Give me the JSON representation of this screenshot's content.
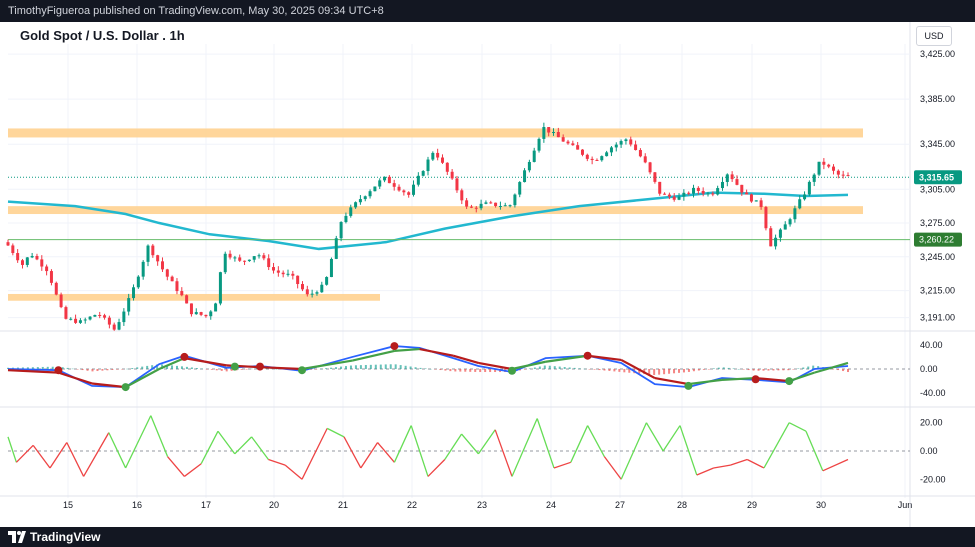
{
  "header": {
    "publisher_line": "TimothyFigueroa published on TradingView.com, May 30, 2025 09:34 UTC+8"
  },
  "footer": {
    "brand": "TradingView"
  },
  "chart_data": {
    "type": "candlestick",
    "title": "Gold Spot / U.S. Dollar . 1h",
    "currency": "USD",
    "colors": {
      "up": "#089981",
      "down": "#f23645",
      "ma": "#22b8cf",
      "zone": "#ffcf8a",
      "bg": "#ffffff",
      "macd_fast": "#2962ff",
      "macd_slow_up": "#43a047",
      "macd_slow_down": "#b71c1c",
      "hist_up": "#26a69a",
      "hist_down": "#ef5350",
      "osc_up": "#66dd55",
      "osc_down": "#ee4444",
      "price_tag": "#089981",
      "level_tag": "#2e7d32"
    },
    "x_tick_labels": [
      "15",
      "16",
      "17",
      "20",
      "21",
      "22",
      "23",
      "24",
      "27",
      "28",
      "29",
      "30",
      "Jun"
    ],
    "price_axis": {
      "ticks": [
        "3,425.00",
        "3,385.00",
        "3,345.00",
        "3,305.00",
        "3,275.00",
        "3,245.00",
        "3,215.00",
        "3,191.00"
      ]
    },
    "last_price": "3,315.65",
    "horizontal_level": "3,260.22",
    "zones": [
      {
        "from_day": "14",
        "to_day": "30",
        "low": 3351,
        "high": 3359
      },
      {
        "from_day": "14",
        "to_day": "30",
        "low": 3283,
        "high": 3290
      },
      {
        "from_day": "14",
        "to_day": "21",
        "low": 3206,
        "high": 3212
      }
    ],
    "moving_average": [
      [
        0,
        3294
      ],
      [
        0.08,
        3290
      ],
      [
        0.14,
        3283
      ],
      [
        0.18,
        3275
      ],
      [
        0.24,
        3265
      ],
      [
        0.31,
        3259
      ],
      [
        0.37,
        3252
      ],
      [
        0.45,
        3258
      ],
      [
        0.52,
        3270
      ],
      [
        0.6,
        3281
      ],
      [
        0.68,
        3290
      ],
      [
        0.76,
        3296
      ],
      [
        0.84,
        3302
      ],
      [
        0.9,
        3301
      ],
      [
        0.95,
        3299
      ],
      [
        1,
        3300
      ]
    ],
    "price_path": [
      [
        0,
        3258
      ],
      [
        0.02,
        3238
      ],
      [
        0.03,
        3248
      ],
      [
        0.05,
        3233
      ],
      [
        0.07,
        3190
      ],
      [
        0.09,
        3187
      ],
      [
        0.11,
        3195
      ],
      [
        0.13,
        3180
      ],
      [
        0.15,
        3212
      ],
      [
        0.17,
        3255
      ],
      [
        0.19,
        3230
      ],
      [
        0.21,
        3210
      ],
      [
        0.22,
        3196
      ],
      [
        0.24,
        3192
      ],
      [
        0.25,
        3205
      ],
      [
        0.26,
        3250
      ],
      [
        0.28,
        3240
      ],
      [
        0.3,
        3248
      ],
      [
        0.32,
        3232
      ],
      [
        0.34,
        3228
      ],
      [
        0.36,
        3210
      ],
      [
        0.38,
        3220
      ],
      [
        0.4,
        3278
      ],
      [
        0.42,
        3295
      ],
      [
        0.45,
        3315
      ],
      [
        0.48,
        3300
      ],
      [
        0.51,
        3340
      ],
      [
        0.53,
        3315
      ],
      [
        0.55,
        3287
      ],
      [
        0.57,
        3292
      ],
      [
        0.6,
        3290
      ],
      [
        0.62,
        3325
      ],
      [
        0.64,
        3360
      ],
      [
        0.66,
        3350
      ],
      [
        0.68,
        3340
      ],
      [
        0.7,
        3330
      ],
      [
        0.72,
        3342
      ],
      [
        0.74,
        3350
      ],
      [
        0.76,
        3330
      ],
      [
        0.78,
        3300
      ],
      [
        0.8,
        3297
      ],
      [
        0.82,
        3305
      ],
      [
        0.84,
        3300
      ],
      [
        0.86,
        3320
      ],
      [
        0.88,
        3300
      ],
      [
        0.9,
        3290
      ],
      [
        0.91,
        3255
      ],
      [
        0.93,
        3275
      ],
      [
        0.95,
        3300
      ],
      [
        0.97,
        3330
      ],
      [
        0.99,
        3318
      ],
      [
        1,
        3316
      ]
    ],
    "macd_axis": {
      "ticks": [
        "40.00",
        "0.00",
        "-40.00"
      ],
      "range": [
        -58,
        58
      ]
    },
    "macd_fast": [
      [
        0,
        0
      ],
      [
        0.06,
        -2
      ],
      [
        0.1,
        -28
      ],
      [
        0.14,
        -30
      ],
      [
        0.18,
        8
      ],
      [
        0.21,
        22
      ],
      [
        0.26,
        2
      ],
      [
        0.3,
        5
      ],
      [
        0.35,
        -3
      ],
      [
        0.41,
        20
      ],
      [
        0.46,
        38
      ],
      [
        0.49,
        35
      ],
      [
        0.53,
        18
      ],
      [
        0.56,
        5
      ],
      [
        0.6,
        -5
      ],
      [
        0.64,
        18
      ],
      [
        0.69,
        22
      ],
      [
        0.73,
        10
      ],
      [
        0.77,
        -25
      ],
      [
        0.81,
        -30
      ],
      [
        0.85,
        -15
      ],
      [
        0.89,
        -18
      ],
      [
        0.93,
        -22
      ],
      [
        0.96,
        0
      ],
      [
        1,
        5
      ]
    ],
    "macd_slow": [
      [
        0,
        -2
      ],
      [
        0.06,
        -6
      ],
      [
        0.1,
        -24
      ],
      [
        0.14,
        -30
      ],
      [
        0.18,
        0
      ],
      [
        0.21,
        18
      ],
      [
        0.26,
        6
      ],
      [
        0.3,
        3
      ],
      [
        0.35,
        0
      ],
      [
        0.41,
        14
      ],
      [
        0.46,
        30
      ],
      [
        0.49,
        33
      ],
      [
        0.53,
        22
      ],
      [
        0.56,
        10
      ],
      [
        0.6,
        0
      ],
      [
        0.64,
        12
      ],
      [
        0.69,
        22
      ],
      [
        0.73,
        15
      ],
      [
        0.77,
        -15
      ],
      [
        0.81,
        -25
      ],
      [
        0.85,
        -18
      ],
      [
        0.89,
        -15
      ],
      [
        0.93,
        -20
      ],
      [
        0.96,
        -6
      ],
      [
        1,
        10
      ]
    ],
    "macd_crosses": [
      [
        0.06,
        -2,
        "down"
      ],
      [
        0.14,
        -30,
        "up"
      ],
      [
        0.21,
        20,
        "down"
      ],
      [
        0.27,
        4,
        "up"
      ],
      [
        0.3,
        4,
        "down"
      ],
      [
        0.35,
        -2,
        "up"
      ],
      [
        0.46,
        38,
        "down"
      ],
      [
        0.6,
        -3,
        "up"
      ],
      [
        0.69,
        22,
        "down"
      ],
      [
        0.81,
        -28,
        "up"
      ],
      [
        0.89,
        -17,
        "down"
      ],
      [
        0.93,
        -20,
        "up"
      ]
    ],
    "osc_axis": {
      "ticks": [
        "20.00",
        "0.00",
        "-20.00"
      ],
      "range": [
        -29,
        29
      ]
    },
    "oscillator": [
      [
        0,
        10
      ],
      [
        0.01,
        -8
      ],
      [
        0.03,
        4
      ],
      [
        0.05,
        -12
      ],
      [
        0.07,
        6
      ],
      [
        0.09,
        -18
      ],
      [
        0.12,
        13
      ],
      [
        0.14,
        -12
      ],
      [
        0.17,
        25
      ],
      [
        0.19,
        -4
      ],
      [
        0.21,
        -18
      ],
      [
        0.23,
        -9
      ],
      [
        0.25,
        14
      ],
      [
        0.27,
        -2
      ],
      [
        0.29,
        10
      ],
      [
        0.31,
        -6
      ],
      [
        0.33,
        -10
      ],
      [
        0.35,
        -20
      ],
      [
        0.38,
        16
      ],
      [
        0.4,
        10
      ],
      [
        0.42,
        -12
      ],
      [
        0.44,
        6
      ],
      [
        0.46,
        -8
      ],
      [
        0.48,
        18
      ],
      [
        0.5,
        -18
      ],
      [
        0.52,
        -6
      ],
      [
        0.54,
        12
      ],
      [
        0.56,
        -2
      ],
      [
        0.58,
        15
      ],
      [
        0.6,
        -18
      ],
      [
        0.63,
        23
      ],
      [
        0.65,
        -12
      ],
      [
        0.67,
        -8
      ],
      [
        0.69,
        18
      ],
      [
        0.71,
        -4
      ],
      [
        0.73,
        -20
      ],
      [
        0.76,
        20
      ],
      [
        0.78,
        0
      ],
      [
        0.8,
        18
      ],
      [
        0.82,
        -17
      ],
      [
        0.84,
        -12
      ],
      [
        0.86,
        -10
      ],
      [
        0.88,
        -6
      ],
      [
        0.9,
        -12
      ],
      [
        0.93,
        20
      ],
      [
        0.95,
        14
      ],
      [
        0.97,
        -14
      ],
      [
        1,
        -6
      ]
    ]
  }
}
